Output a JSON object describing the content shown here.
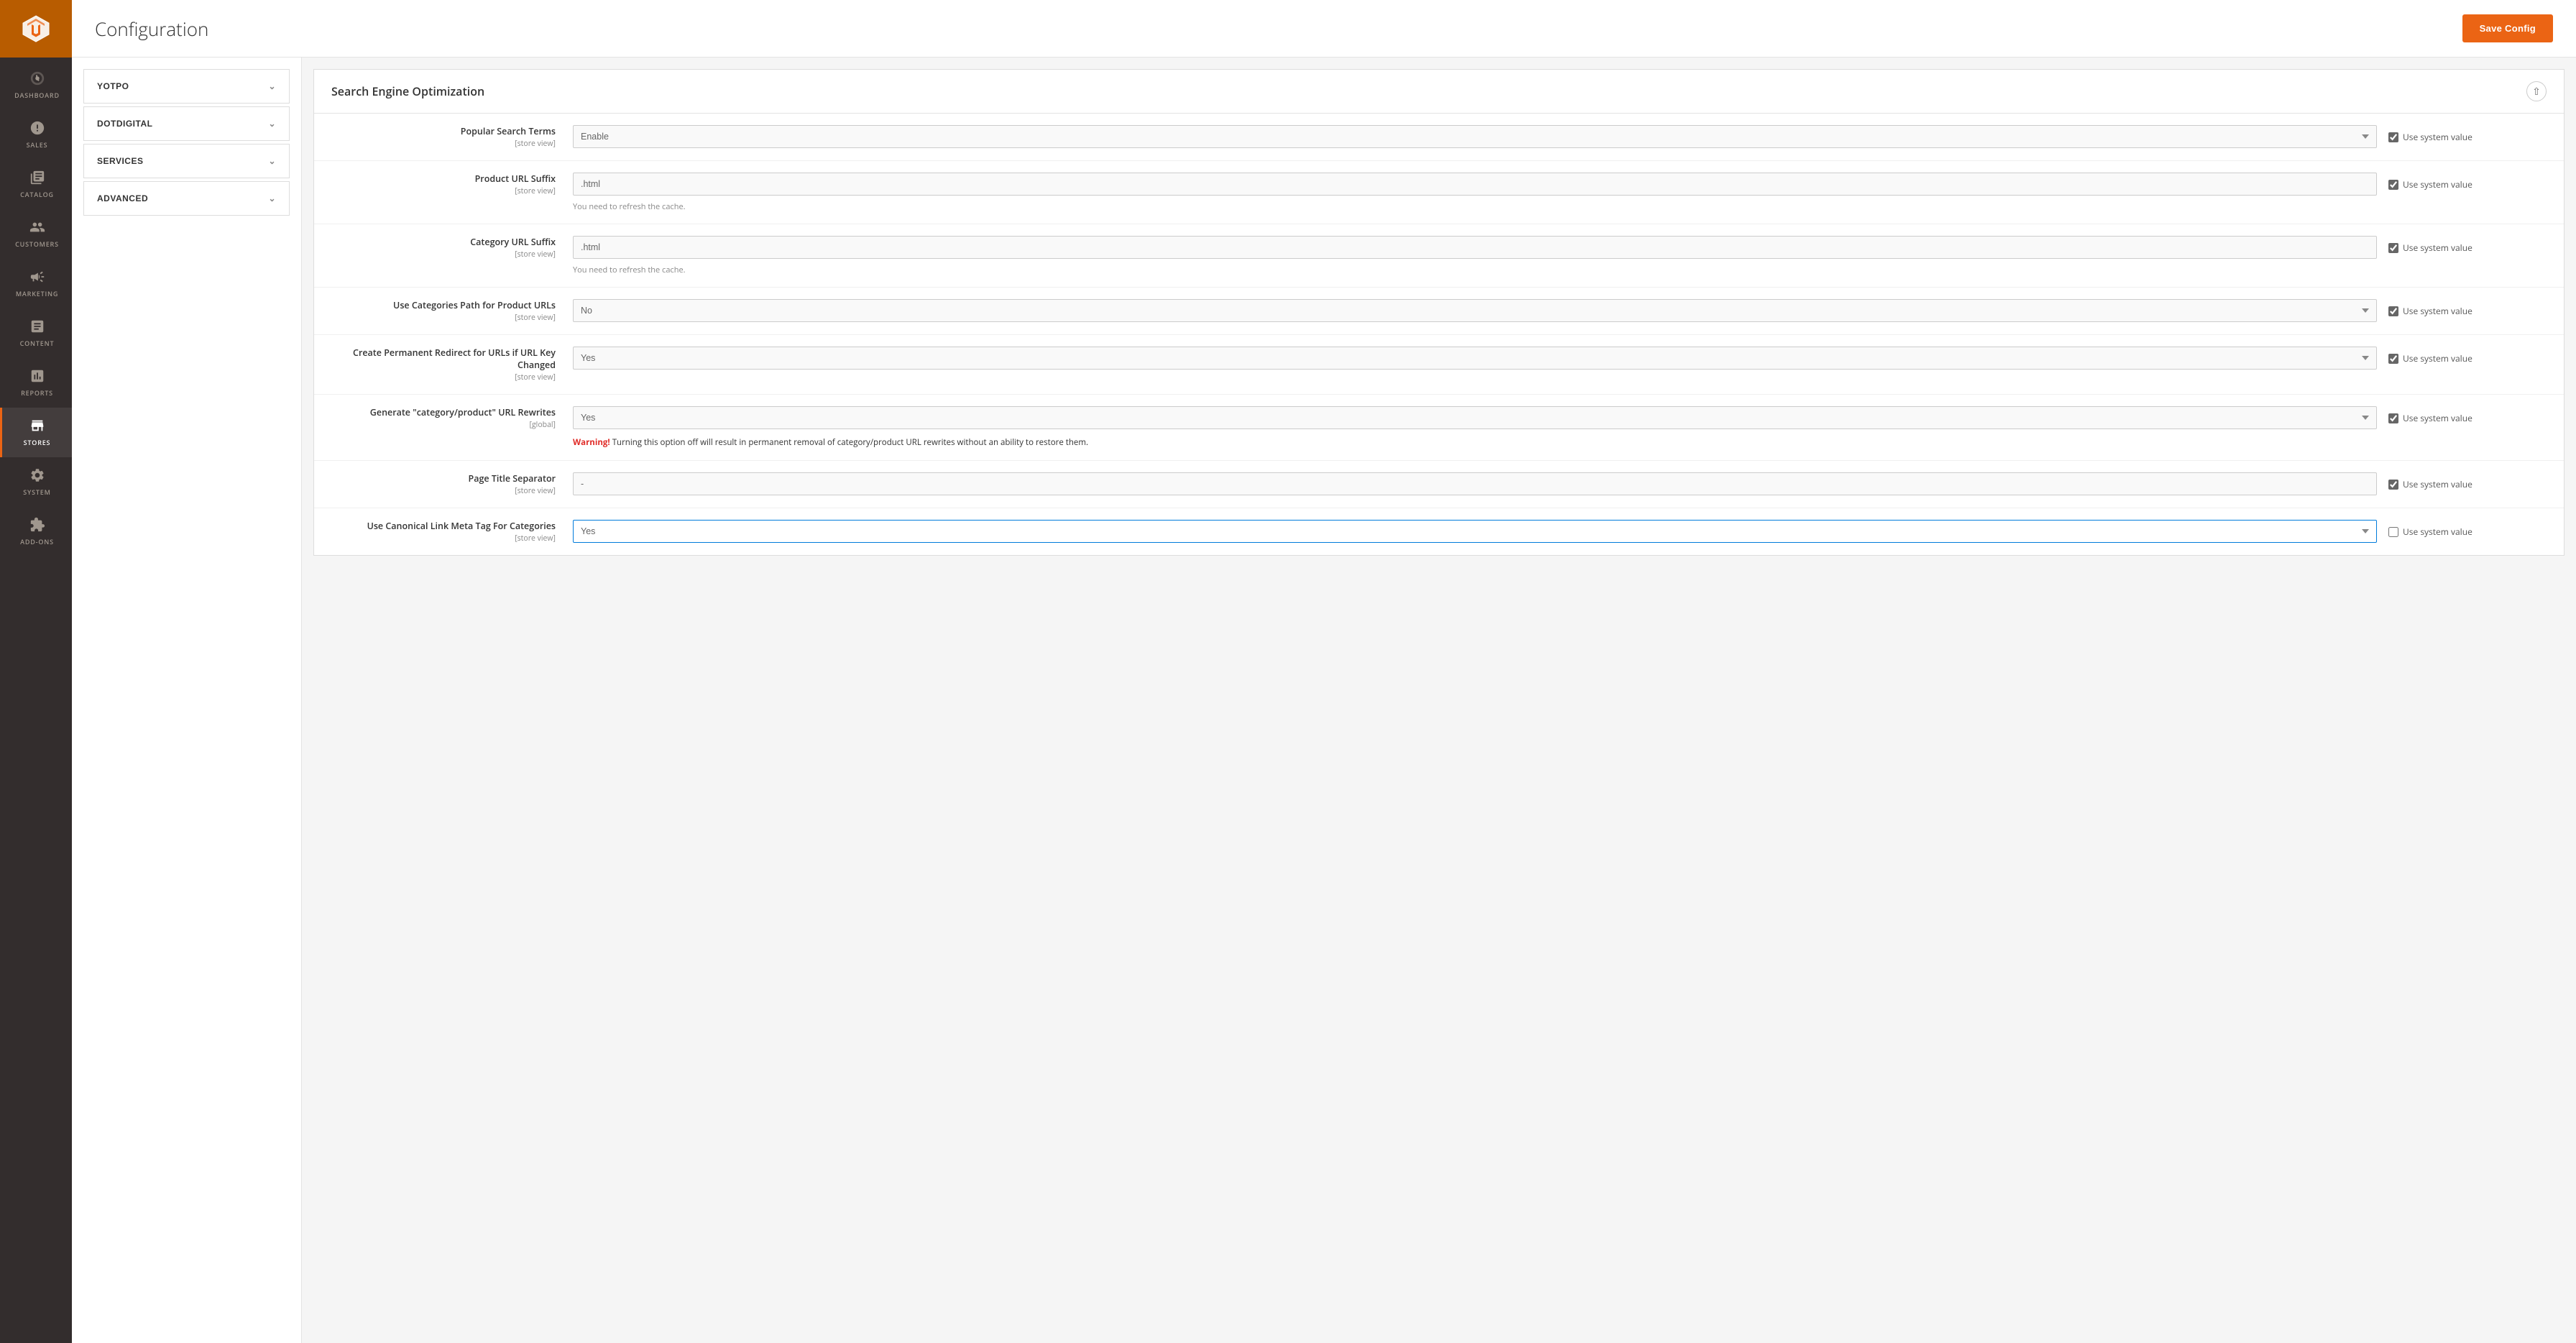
{
  "page": {
    "title": "Configuration"
  },
  "header": {
    "save_button": "Save Config"
  },
  "sidebar": {
    "items": [
      {
        "id": "dashboard",
        "label": "DASHBOARD",
        "icon": "dashboard"
      },
      {
        "id": "sales",
        "label": "SALES",
        "icon": "sales"
      },
      {
        "id": "catalog",
        "label": "CATALOG",
        "icon": "catalog"
      },
      {
        "id": "customers",
        "label": "CUSTOMERS",
        "icon": "customers"
      },
      {
        "id": "marketing",
        "label": "MARKETING",
        "icon": "marketing"
      },
      {
        "id": "content",
        "label": "CONTENT",
        "icon": "content"
      },
      {
        "id": "reports",
        "label": "REPORTS",
        "icon": "reports"
      },
      {
        "id": "stores",
        "label": "STORES",
        "icon": "stores",
        "active": true
      },
      {
        "id": "system",
        "label": "SYSTEM",
        "icon": "system"
      },
      {
        "id": "partners",
        "label": "ADD-ONS",
        "icon": "partners"
      }
    ]
  },
  "left_panel": {
    "accordion_items": [
      {
        "id": "yotpo",
        "label": "YOTPO"
      },
      {
        "id": "dotdigital",
        "label": "DOTDIGITAL"
      },
      {
        "id": "services",
        "label": "SERVICES"
      },
      {
        "id": "advanced",
        "label": "ADVANCED"
      }
    ]
  },
  "section": {
    "title": "Search Engine Optimization",
    "rows": [
      {
        "id": "popular_search_terms",
        "label": "Popular Search Terms",
        "scope": "[store view]",
        "input_type": "select",
        "value": "Enable",
        "active": false,
        "use_system_value": true,
        "cache_notice": null,
        "warning": null
      },
      {
        "id": "product_url_suffix",
        "label": "Product URL Suffix",
        "scope": "[store view]",
        "input_type": "text",
        "value": ".html",
        "active": false,
        "use_system_value": true,
        "cache_notice": "You need to refresh the cache.",
        "warning": null
      },
      {
        "id": "category_url_suffix",
        "label": "Category URL Suffix",
        "scope": "[store view]",
        "input_type": "text",
        "value": ".html",
        "active": false,
        "use_system_value": true,
        "cache_notice": "You need to refresh the cache.",
        "warning": null
      },
      {
        "id": "use_categories_path",
        "label": "Use Categories Path for Product URLs",
        "scope": "[store view]",
        "input_type": "select",
        "value": "No",
        "active": false,
        "use_system_value": true,
        "cache_notice": null,
        "warning": null
      },
      {
        "id": "permanent_redirect",
        "label": "Create Permanent Redirect for URLs if URL Key Changed",
        "scope": "[store view]",
        "input_type": "select",
        "value": "Yes",
        "active": false,
        "use_system_value": true,
        "cache_notice": null,
        "warning": null
      },
      {
        "id": "generate_url_rewrites",
        "label": "Generate \"category/product\" URL Rewrites",
        "scope": "[global]",
        "input_type": "select",
        "value": "Yes",
        "active": false,
        "use_system_value": true,
        "cache_notice": null,
        "warning": "Warning! Turning this option off will result in permanent removal of category/product URL rewrites without an ability to restore them.",
        "warning_label": "Warning!"
      },
      {
        "id": "page_title_separator",
        "label": "Page Title Separator",
        "scope": "[store view]",
        "input_type": "text",
        "value": "-",
        "active": false,
        "use_system_value": true,
        "cache_notice": null,
        "warning": null
      },
      {
        "id": "canonical_link_categories",
        "label": "Use Canonical Link Meta Tag For Categories",
        "scope": "[store view]",
        "input_type": "select",
        "value": "Yes",
        "active": true,
        "use_system_value": false,
        "cache_notice": null,
        "warning": null
      }
    ]
  }
}
